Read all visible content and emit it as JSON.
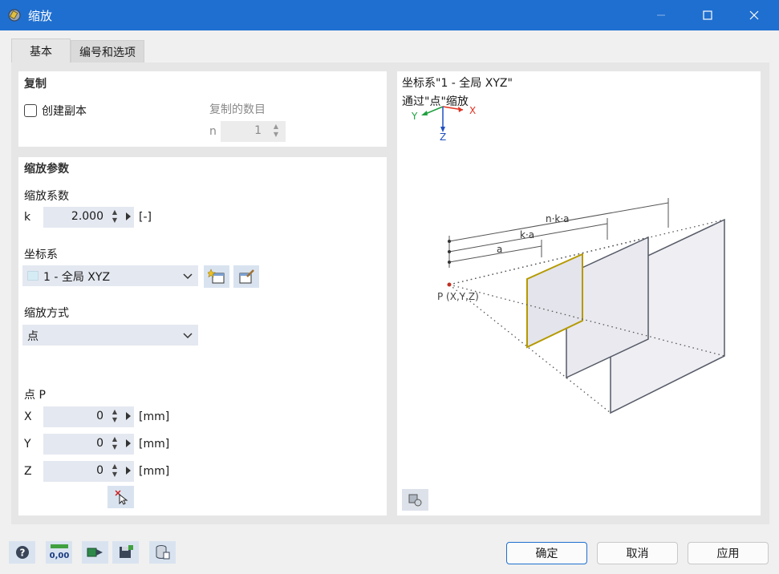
{
  "window": {
    "title": "缩放"
  },
  "tabs": [
    {
      "label": "基本"
    },
    {
      "label": "编号和选项"
    }
  ],
  "copy_section": {
    "title": "复制",
    "create_copy_label": "创建副本",
    "count_label": "复制的数目",
    "n_label": "n",
    "n_value": "1"
  },
  "scale_section": {
    "title": "缩放参数",
    "factor_label": "缩放系数",
    "k_label": "k",
    "k_value": "2.000",
    "k_unit": "[-]",
    "cs_label": "坐标系",
    "cs_value": "1 - 全局 XYZ",
    "method_label": "缩放方式",
    "method_value": "点",
    "point_label": "点 P",
    "x_label": "X",
    "x_value": "0",
    "y_label": "Y",
    "y_value": "0",
    "z_label": "Z",
    "z_value": "0",
    "unit_mm": "[mm]"
  },
  "preview": {
    "line1": "坐标系\"1 - 全局 XYZ\"",
    "line2": "通过\"点\"缩放",
    "axis_x": "X",
    "axis_y": "Y",
    "axis_z": "Z",
    "label_nka": "n·k·a",
    "label_ka": "k·a",
    "label_a": "a",
    "label_p": "P (X,Y,Z)"
  },
  "buttons": {
    "ok": "确定",
    "cancel": "取消",
    "apply": "应用"
  },
  "colors": {
    "titlebar": "#1f6fd0",
    "highlight_frame": "#b59a00",
    "axis_x": "#e03020",
    "axis_y": "#20a040",
    "axis_z": "#2050c0"
  }
}
